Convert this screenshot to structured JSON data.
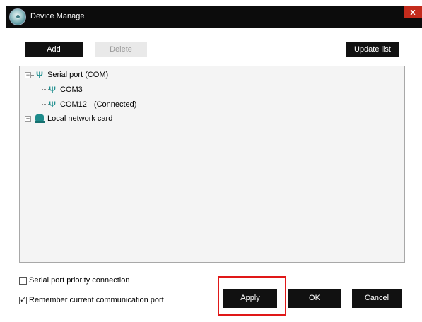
{
  "window": {
    "title": "Device Manage",
    "close_glyph": "x"
  },
  "toolbar": {
    "add_label": "Add",
    "delete_label": "Delete",
    "update_label": "Update list"
  },
  "tree": {
    "items": [
      {
        "label": "Serial port (COM)",
        "icon": "usb-icon",
        "expander": "−"
      },
      {
        "label": "COM3",
        "icon": "usb-icon"
      },
      {
        "label": "COM12",
        "status": "(Connected)",
        "icon": "usb-icon"
      },
      {
        "label": "Local network card",
        "icon": "network-card-icon",
        "expander": "+"
      }
    ]
  },
  "options": {
    "priority_label": "Serial port priority connection",
    "priority_checked": false,
    "remember_label": "Remember current communication port",
    "remember_checked": true,
    "check_glyph": "✓"
  },
  "footer": {
    "apply_label": "Apply",
    "ok_label": "OK",
    "cancel_label": "Cancel"
  },
  "colors": {
    "highlight": "#e01818",
    "titlebar": "#0c0c0c",
    "icon_teal": "#1f8f8f"
  }
}
